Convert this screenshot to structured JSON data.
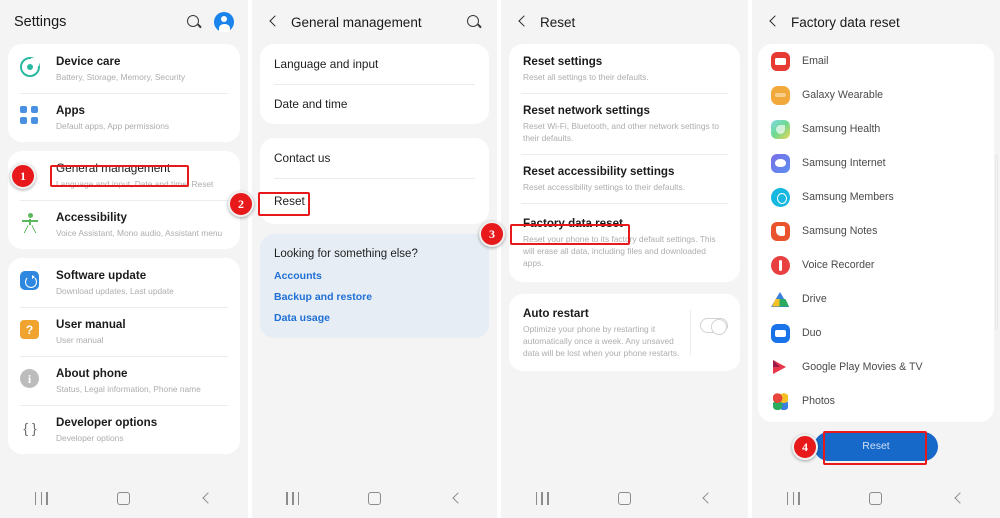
{
  "panels": {
    "settings": {
      "title": "Settings",
      "search_icon": "search-icon",
      "avatar_icon": "account-avatar-icon",
      "groups": [
        {
          "items": [
            {
              "icon": "device-care-icon",
              "title": "Device care",
              "subtitle": "Battery, Storage, Memory, Security"
            },
            {
              "icon": "apps-grid-icon",
              "title": "Apps",
              "subtitle": "Default apps, App permissions"
            }
          ]
        },
        {
          "items": [
            {
              "icon": "",
              "title": "General management",
              "subtitle": "Language and input, Date and time, Reset"
            },
            {
              "icon": "accessibility-icon",
              "title": "Accessibility",
              "subtitle": "Voice Assistant, Mono audio, Assistant menu"
            }
          ]
        },
        {
          "items": [
            {
              "icon": "software-update-icon",
              "title": "Software update",
              "subtitle": "Download updates, Last update"
            },
            {
              "icon": "user-manual-icon",
              "title": "User manual",
              "subtitle": "User manual"
            },
            {
              "icon": "about-phone-icon",
              "title": "About phone",
              "subtitle": "Status, Legal information, Phone name"
            },
            {
              "icon": "developer-options-icon",
              "title": "Developer options",
              "subtitle": "Developer options"
            }
          ]
        }
      ]
    },
    "general_management": {
      "title": "General management",
      "search_icon": "search-icon",
      "group_one": [
        "Language and input",
        "Date and time"
      ],
      "group_two": [
        "Contact us",
        "Reset"
      ],
      "looking": {
        "title": "Looking for something else?",
        "links": [
          "Accounts",
          "Backup and restore",
          "Data usage"
        ]
      }
    },
    "reset": {
      "title": "Reset",
      "items": [
        {
          "title": "Reset settings",
          "subtitle": "Reset all settings to their defaults."
        },
        {
          "title": "Reset network settings",
          "subtitle": "Reset Wi-Fi, Bluetooth, and other network settings to their defaults."
        },
        {
          "title": "Reset accessibility settings",
          "subtitle": "Reset accessibility settings to their defaults."
        },
        {
          "title": "Factory data reset",
          "subtitle": "Reset your phone to its factory default settings. This will erase all data, including files and downloaded apps."
        }
      ],
      "auto_restart": {
        "title": "Auto restart",
        "subtitle": "Optimize your phone by restarting it automatically once a week. Any unsaved data will be lost when your phone restarts.",
        "toggle_state": "off"
      }
    },
    "factory_data_reset": {
      "title": "Factory data reset",
      "apps": [
        {
          "icon": "email-app-icon",
          "label": "Email"
        },
        {
          "icon": "galaxy-wearable-app-icon",
          "label": "Galaxy Wearable"
        },
        {
          "icon": "samsung-health-app-icon",
          "label": "Samsung Health"
        },
        {
          "icon": "samsung-internet-app-icon",
          "label": "Samsung Internet"
        },
        {
          "icon": "samsung-members-app-icon",
          "label": "Samsung Members"
        },
        {
          "icon": "samsung-notes-app-icon",
          "label": "Samsung Notes"
        },
        {
          "icon": "voice-recorder-app-icon",
          "label": "Voice Recorder"
        },
        {
          "icon": "drive-app-icon",
          "label": "Drive"
        },
        {
          "icon": "duo-app-icon",
          "label": "Duo"
        },
        {
          "icon": "google-play-movies-app-icon",
          "label": "Google Play Movies & TV"
        },
        {
          "icon": "photos-app-icon",
          "label": "Photos"
        }
      ],
      "reset_button": "Reset"
    }
  },
  "navbar": {
    "recents_icon": "recents-icon",
    "home_icon": "home-icon",
    "back_icon": "back-icon"
  },
  "annotations": {
    "steps": [
      {
        "number": "1",
        "target": "General management"
      },
      {
        "number": "2",
        "target": "Reset"
      },
      {
        "number": "3",
        "target": "Factory data reset"
      },
      {
        "number": "4",
        "target": "Reset"
      }
    ],
    "highlight_color": "#e8191b",
    "badge_color": "#e8191b"
  },
  "colors": {
    "panel_bg": "#f4f4f4",
    "card_bg": "#ffffff",
    "tinted_card_bg": "#e6edf4",
    "link_blue": "#1f6fd4",
    "button_blue": "#1668c9",
    "accent_red": "#e8191b"
  }
}
